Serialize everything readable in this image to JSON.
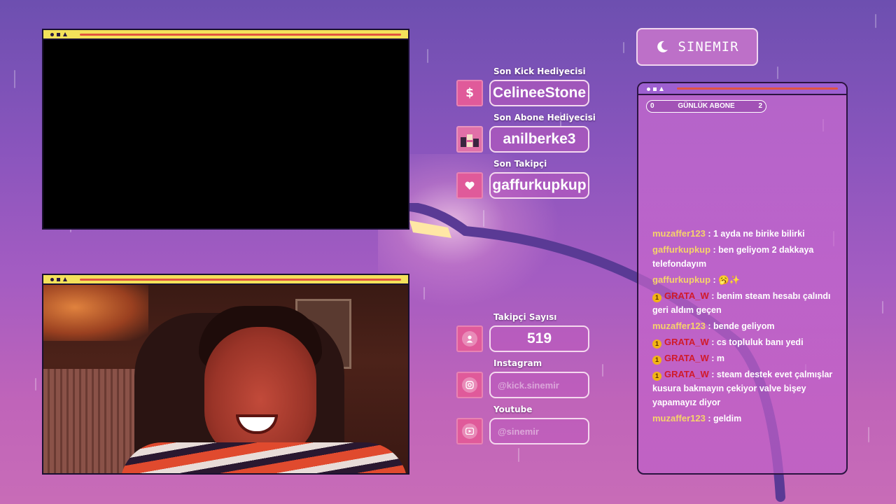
{
  "colors": {
    "accent_yellow": "#f4e15a",
    "accent_pink": "#e05a9a",
    "username_gold": "#f6d36a",
    "username_red": "#d11a2a"
  },
  "panels": {
    "gift_label": "Son Kick Hediyecisi",
    "gift_value": "CelineeStone",
    "gift_icon": "dollar-icon",
    "sub_gift_label": "Son Abone Hediyecisi",
    "sub_gift_value": "anilberke3",
    "sub_gift_icon": "gift-box-icon",
    "follower_label": "Son Takipçi",
    "follower_value": "gaffurkupkup",
    "follower_icon": "heart-icon",
    "follower_count_label": "Takipçi Sayısı",
    "follower_count_value": "519",
    "follower_count_icon": "user-icon",
    "instagram_label": "Instagram",
    "instagram_value": "@kick.sinemir",
    "instagram_icon": "instagram-icon",
    "youtube_label": "Youtube",
    "youtube_value": "@sinemir",
    "youtube_icon": "youtube-icon"
  },
  "brand": {
    "name": "SINEMIR",
    "icon": "moon-icon"
  },
  "chat": {
    "goal": {
      "title": "GÜNLÜK ABONE",
      "min": "0",
      "max": "2"
    },
    "messages": [
      {
        "user": "muzaffer123",
        "text": ": 1 ayda ne birike bilirki",
        "color": "#f6d36a",
        "badge": ""
      },
      {
        "user": "gaffurkupkup",
        "text": ": ben geliyom 2 dakkaya telefondayım",
        "color": "#f6d36a",
        "badge": ""
      },
      {
        "user": "gaffurkupkup",
        "text": ": 🥱✨",
        "color": "#f6d36a",
        "badge": ""
      },
      {
        "user": "GRATA_W",
        "text": ": benim steam hesabı çalındı geri aldım geçen",
        "color": "#d11a2a",
        "badge": "1"
      },
      {
        "user": "muzaffer123",
        "text": ": bende geliyom",
        "color": "#f6d36a",
        "badge": ""
      },
      {
        "user": "GRATA_W",
        "text": ": cs topluluk banı yedi",
        "color": "#d11a2a",
        "badge": "1"
      },
      {
        "user": "GRATA_W",
        "text": ": m",
        "color": "#d11a2a",
        "badge": "1"
      },
      {
        "user": "GRATA_W",
        "text": ": steam destek evet çalmışlar kusura bakmayın çekiyor valve bişey yapamayız diyor",
        "color": "#d11a2a",
        "badge": "1"
      },
      {
        "user": "muzaffer123",
        "text": ": geldim",
        "color": "#f6d36a",
        "badge": ""
      }
    ]
  }
}
